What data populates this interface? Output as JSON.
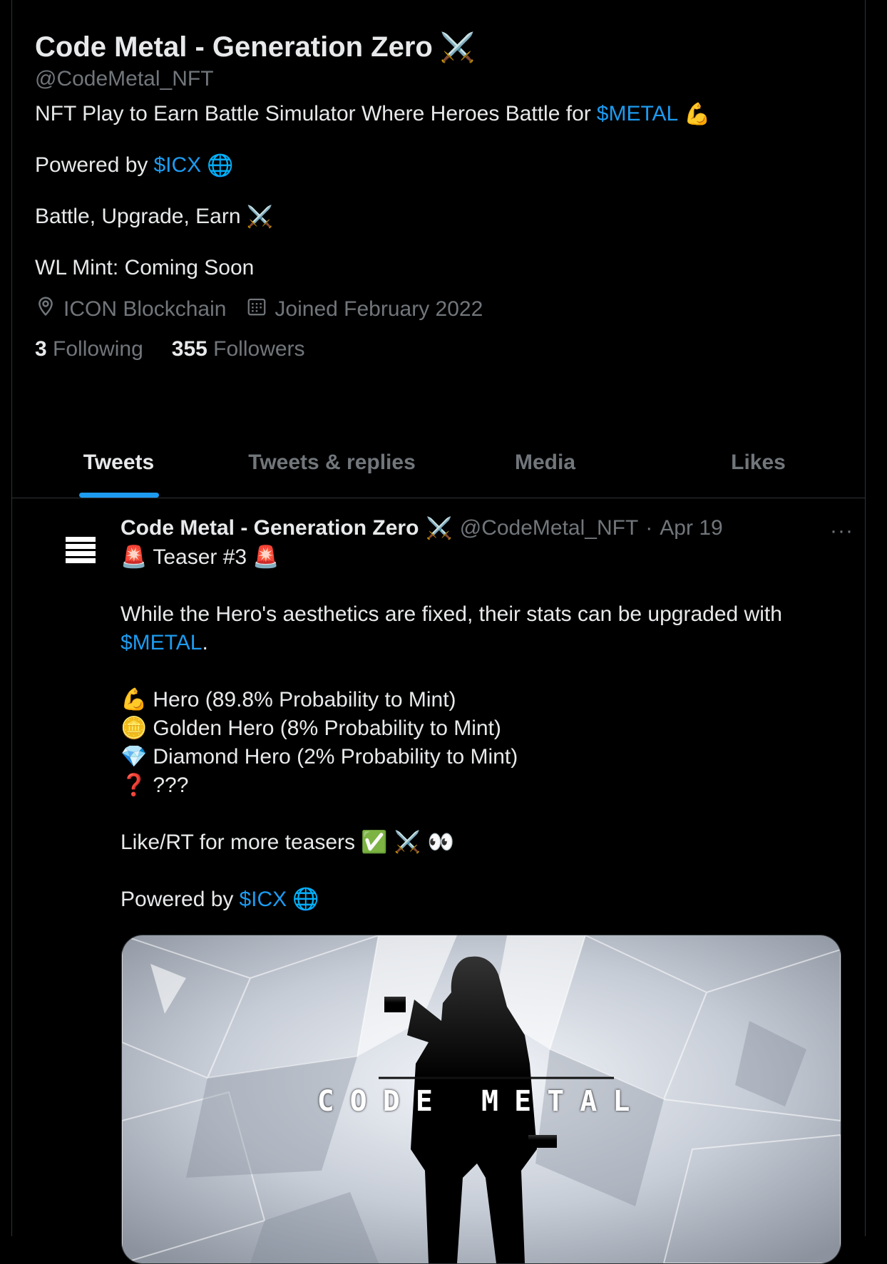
{
  "profile": {
    "name": "Code Metal - Generation Zero",
    "name_emoji": "⚔️",
    "handle": "@CodeMetal_NFT",
    "bio": {
      "line1_text": "NFT Play to Earn Battle Simulator Where Heroes Battle for",
      "line1_link": "$METAL",
      "line1_emoji": "💪",
      "line2_text": "Powered by",
      "line2_link": "$ICX",
      "line2_emoji": "🌐",
      "line3_text": "Battle, Upgrade, Earn",
      "line3_emoji": "⚔️",
      "line4_text": "WL Mint: Coming Soon"
    },
    "location": "ICON Blockchain",
    "joined": "Joined February 2022",
    "following_count": "3",
    "following_label": "Following",
    "followers_count": "355",
    "followers_label": "Followers"
  },
  "tabs": [
    {
      "label": "Tweets",
      "active": true
    },
    {
      "label": "Tweets & replies",
      "active": false
    },
    {
      "label": "Media",
      "active": false
    },
    {
      "label": "Likes",
      "active": false
    }
  ],
  "tweet": {
    "author": "Code Metal - Generation Zero",
    "author_emoji": "⚔️",
    "handle": "@CodeMetal_NFT",
    "separator": "·",
    "date": "Apr 19",
    "more": "···",
    "lines": {
      "teaser_emoji_left": "🚨",
      "teaser": "Teaser #3",
      "teaser_emoji_right": "🚨",
      "p1": "While the Hero's aesthetics are fixed, their stats can be upgraded with",
      "p1_link": "$METAL",
      "p1_end": ".",
      "hero_emoji": "💪",
      "hero": "Hero (89.8% Probability to Mint)",
      "golden_emoji": "🪙",
      "golden": "Golden Hero (8% Probability to Mint)",
      "diamond_emoji": "💎",
      "diamond": "Diamond Hero (2% Probability to Mint)",
      "mystery_emoji": "❓",
      "mystery": "???",
      "cta": "Like/RT for more teasers",
      "cta_emoji": "✅ ⚔️ 👀",
      "powered": "Powered by",
      "powered_link": "$ICX",
      "powered_emoji": "🌐"
    },
    "media_caption": "CODE METAL"
  },
  "colors": {
    "background": "#000000",
    "text": "#e7e9ea",
    "muted": "#71767b",
    "link": "#1d9bf0",
    "border": "#2f3336"
  },
  "icons": {
    "location": "location-pin-icon",
    "calendar": "calendar-icon",
    "avatar": "hamburger-logo-icon"
  }
}
